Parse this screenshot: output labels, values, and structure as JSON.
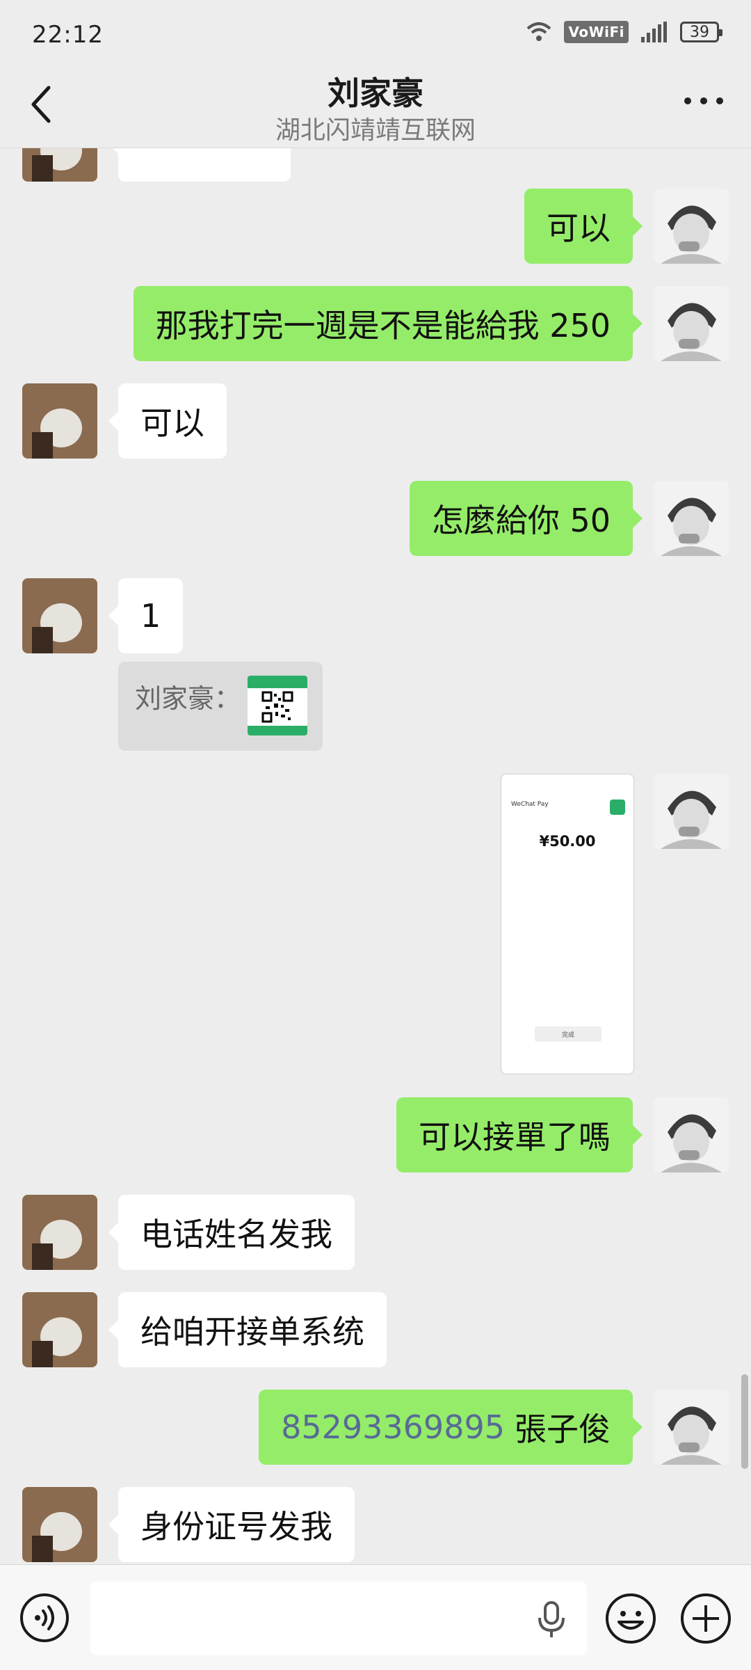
{
  "status_bar": {
    "time": "22:12",
    "network": "VoWiFi",
    "battery": "39"
  },
  "header": {
    "title": "刘家豪",
    "subtitle": "湖北闪靖靖互联网"
  },
  "messages": [
    {
      "dir": "out",
      "text": "可以"
    },
    {
      "dir": "out",
      "text": "那我打完一週是不是能給我 250"
    },
    {
      "dir": "in",
      "text": "可以"
    },
    {
      "dir": "out",
      "text": "怎麼給你 50"
    },
    {
      "dir": "in",
      "text": "1"
    },
    {
      "dir": "out",
      "text": "可以接單了嗎"
    },
    {
      "dir": "in",
      "text": "电话姓名发我"
    },
    {
      "dir": "in",
      "text": "给咱开接单系统"
    },
    {
      "dir": "out",
      "phone": "85293369895",
      "name": "張子俊"
    },
    {
      "dir": "in",
      "text": "身份证号发我"
    }
  ],
  "quote": {
    "label": "刘家豪："
  },
  "payment_screenshot": {
    "brand": "WeChat Pay",
    "amount": "¥50.00",
    "button": "完成"
  },
  "colors": {
    "outgoing_bubble": "#95ec69",
    "incoming_bubble": "#ffffff",
    "background": "#ededed",
    "link": "#576b95"
  },
  "icons": {
    "back": "chevron-left-icon",
    "more": "more-dots-icon",
    "voice": "voice-mode-icon",
    "mic": "microphone-icon",
    "emoji": "emoji-icon",
    "plus": "plus-icon"
  }
}
